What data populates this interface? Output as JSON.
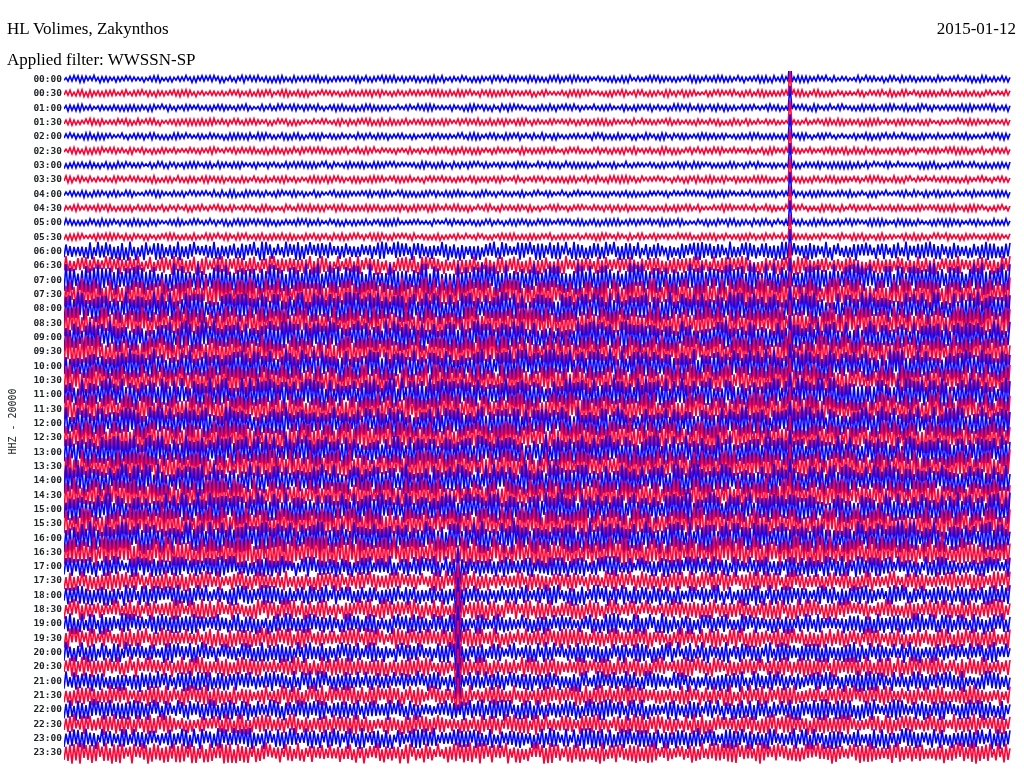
{
  "header": {
    "station": "HL Volimes, Zakynthos",
    "date": "2015-01-12",
    "filter": "Applied filter: WWSSN-SP"
  },
  "helicorder": {
    "axis_label": "HHZ - 20000",
    "rows": [
      {
        "time": "00:00",
        "color": "#0000ff"
      },
      {
        "time": "00:30",
        "color": "#ff0033"
      },
      {
        "time": "01:00",
        "color": "#0000ff"
      },
      {
        "time": "01:30",
        "color": "#ff0033"
      },
      {
        "time": "02:00",
        "color": "#0000ff"
      },
      {
        "time": "02:30",
        "color": "#ff0033"
      },
      {
        "time": "03:00",
        "color": "#0000ff"
      },
      {
        "time": "03:30",
        "color": "#ff0033"
      },
      {
        "time": "04:00",
        "color": "#0000ff"
      },
      {
        "time": "04:30",
        "color": "#ff0033"
      },
      {
        "time": "05:00",
        "color": "#0000ff"
      },
      {
        "time": "05:30",
        "color": "#ff0033"
      },
      {
        "time": "06:00",
        "color": "#0000ff"
      },
      {
        "time": "06:30",
        "color": "#ff0033"
      },
      {
        "time": "07:00",
        "color": "#0000ff"
      },
      {
        "time": "07:30",
        "color": "#ff0033"
      },
      {
        "time": "08:00",
        "color": "#0000ff"
      },
      {
        "time": "08:30",
        "color": "#ff0033"
      },
      {
        "time": "09:00",
        "color": "#0000ff"
      },
      {
        "time": "09:30",
        "color": "#ff0033"
      },
      {
        "time": "10:00",
        "color": "#0000ff"
      },
      {
        "time": "10:30",
        "color": "#ff0033"
      },
      {
        "time": "11:00",
        "color": "#0000ff"
      },
      {
        "time": "11:30",
        "color": "#ff0033"
      },
      {
        "time": "12:00",
        "color": "#0000ff"
      },
      {
        "time": "12:30",
        "color": "#ff0033"
      },
      {
        "time": "13:00",
        "color": "#0000ff"
      },
      {
        "time": "13:30",
        "color": "#ff0033"
      },
      {
        "time": "14:00",
        "color": "#0000ff"
      },
      {
        "time": "14:30",
        "color": "#ff0033"
      },
      {
        "time": "15:00",
        "color": "#0000ff"
      },
      {
        "time": "15:30",
        "color": "#ff0033"
      },
      {
        "time": "16:00",
        "color": "#0000ff"
      },
      {
        "time": "16:30",
        "color": "#ff0033"
      },
      {
        "time": "17:00",
        "color": "#0000ff"
      },
      {
        "time": "17:30",
        "color": "#ff0033"
      },
      {
        "time": "18:00",
        "color": "#0000ff"
      },
      {
        "time": "18:30",
        "color": "#ff0033"
      },
      {
        "time": "19:00",
        "color": "#0000ff"
      },
      {
        "time": "19:30",
        "color": "#ff0033"
      },
      {
        "time": "20:00",
        "color": "#0000ff"
      },
      {
        "time": "20:30",
        "color": "#ff0033"
      },
      {
        "time": "21:00",
        "color": "#0000ff"
      },
      {
        "time": "21:30",
        "color": "#ff0033"
      },
      {
        "time": "22:00",
        "color": "#0000ff"
      },
      {
        "time": "22:30",
        "color": "#ff0033"
      },
      {
        "time": "23:00",
        "color": "#0000ff"
      },
      {
        "time": "23:30",
        "color": "#ff0033"
      }
    ]
  }
}
